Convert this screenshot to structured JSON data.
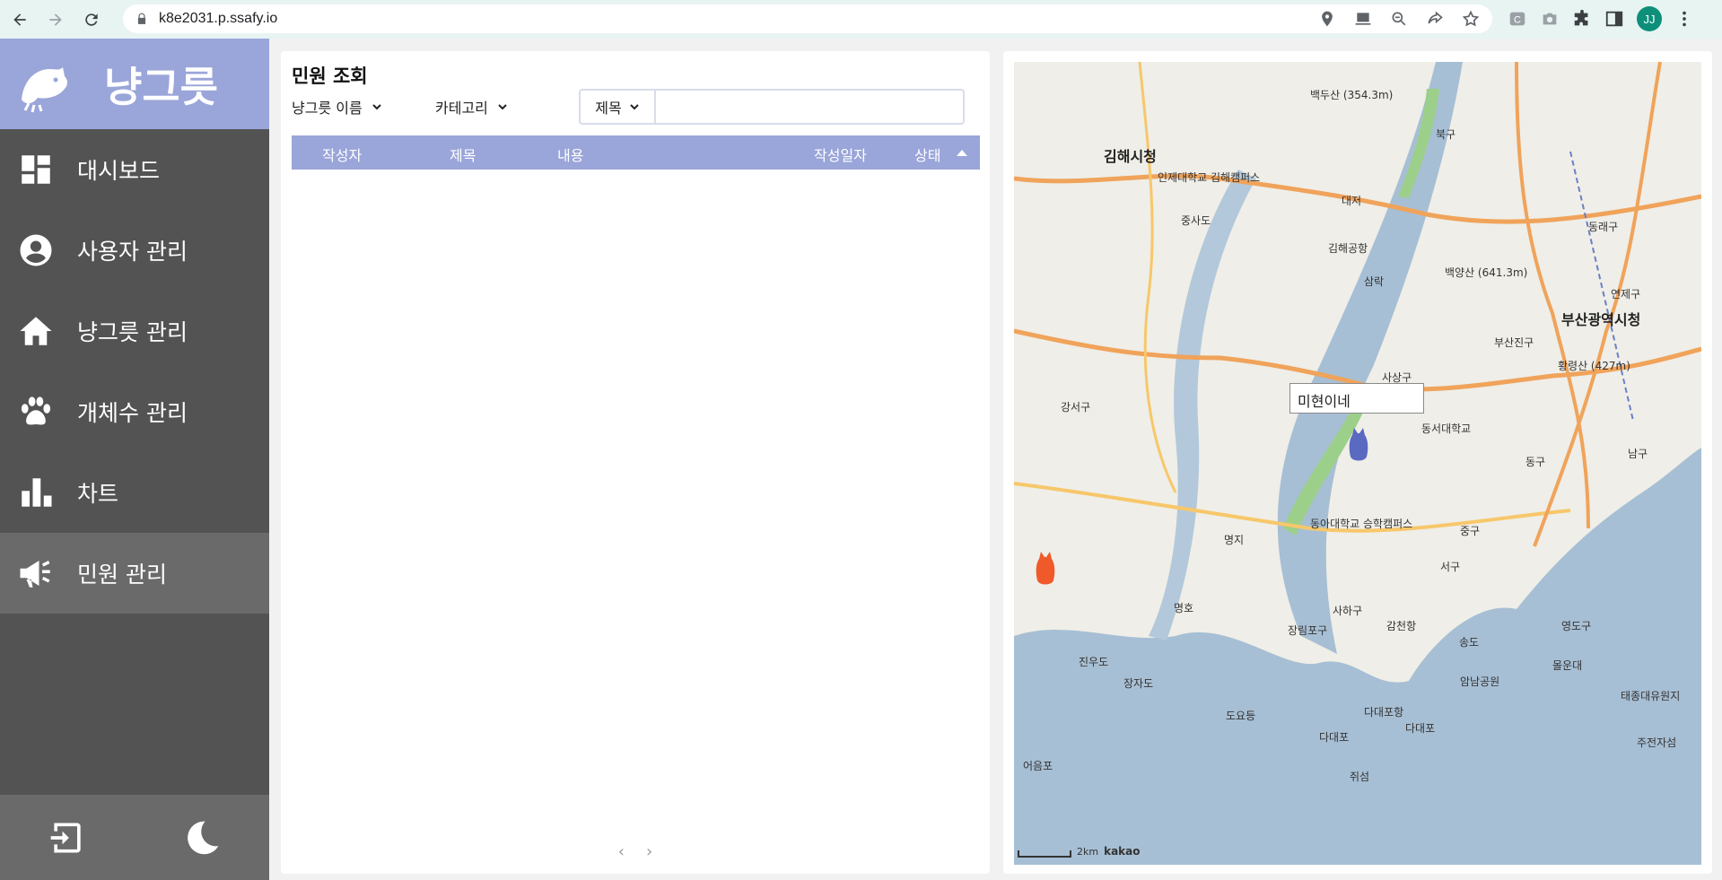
{
  "browser": {
    "url": "k8e2031.p.ssafy.io",
    "profile_initials": "JJ"
  },
  "sidebar": {
    "brand": "냥그릇",
    "items": [
      {
        "label": "대시보드",
        "icon": "dashboard-icon"
      },
      {
        "label": "사용자 관리",
        "icon": "user-icon"
      },
      {
        "label": "냥그릇 관리",
        "icon": "home-icon"
      },
      {
        "label": "개체수 관리",
        "icon": "paw-icon"
      },
      {
        "label": "차트",
        "icon": "bar-chart-icon"
      },
      {
        "label": "민원 관리",
        "icon": "megaphone-icon"
      }
    ],
    "active_index": 5
  },
  "complaints": {
    "title": "민원 조회",
    "filter_bowl": "냥그릇 이름",
    "filter_category": "카테고리",
    "search_type": "제목",
    "search_value": "",
    "columns": [
      "작성자",
      "제목",
      "내용",
      "작성일자",
      "상태"
    ],
    "rows": [],
    "pager_prev": "‹",
    "pager_next": "›"
  },
  "map": {
    "tooltip": "미현이네",
    "labels": {
      "gimhae_city": "김해시청",
      "busan_city": "부산광역시청",
      "gangseo": "강서구",
      "saha": "사하구",
      "buk": "북구",
      "seo": "서구",
      "jung": "중구",
      "dong": "동구",
      "nam": "남구",
      "yeongdo": "영도구",
      "busanjin": "부산진구",
      "sasang": "사상구",
      "yeonje": "연제구",
      "dongrae": "동래구",
      "jungsado": "중사도",
      "daejeo": "대저",
      "gimhae_airport": "김해공항",
      "samrak": "삼락",
      "myeongji": "명지",
      "myeongho": "명호",
      "jangrim": "장림포구",
      "dadaepo": "다대포",
      "dadaepo_port": "다대포항",
      "jinudo": "진우도",
      "jangjado": "장자도",
      "doyodeung": "도요등",
      "eoeungpo": "어음포",
      "jwiseom": "쥐섬",
      "amnam": "암남공원",
      "molundae": "몰운대",
      "gamcheon": "감천항",
      "songdo": "송도",
      "jujeonja": "주전자섬",
      "taejongdae": "태종대유원지",
      "inje": "인제대학교\n김해캠퍼스",
      "dongseo": "동서대학교",
      "donga": "동아대학교\n승학캠퍼스",
      "baegyangsan": "백양산\n(641.3m)",
      "hwangryeongsan": "황령산\n(427m)",
      "baekdusan": "백두산\n(354.3m)",
      "scale": "2km",
      "kakao": "kakao"
    }
  }
}
